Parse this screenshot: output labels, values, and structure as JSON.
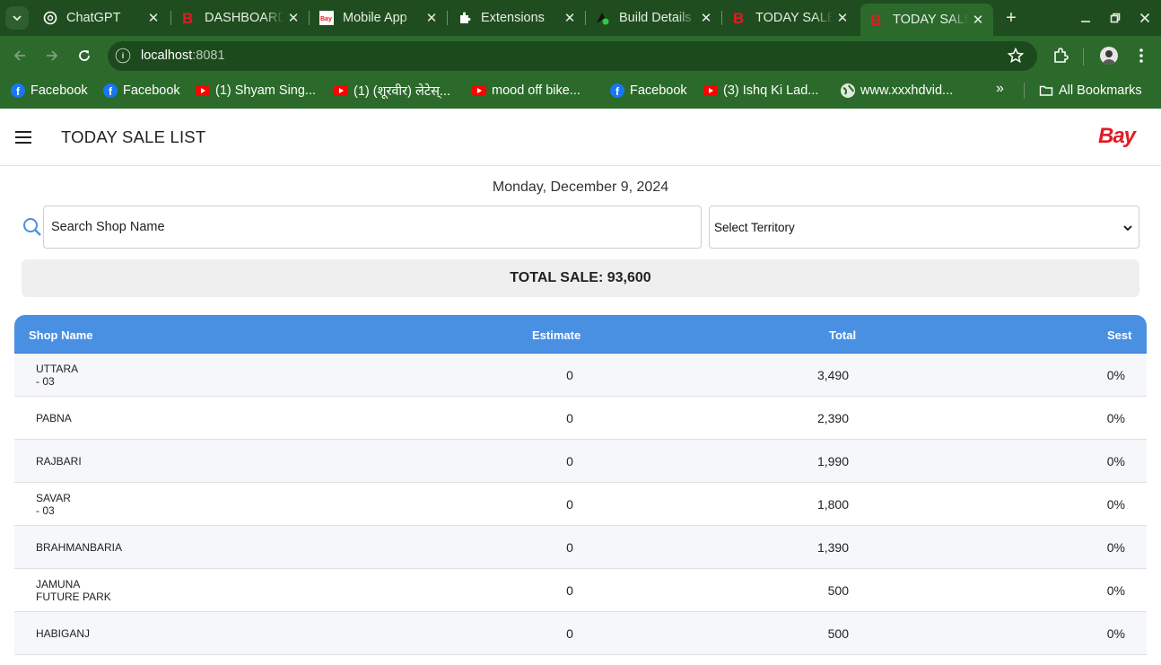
{
  "browser": {
    "tabs": [
      {
        "title": "ChatGPT",
        "icon": "chatgpt-icon"
      },
      {
        "title": "DASHBOARD",
        "icon": "b-red-icon"
      },
      {
        "title": "Mobile App",
        "icon": "bay-icon"
      },
      {
        "title": "Extensions",
        "icon": "puzzle-icon"
      },
      {
        "title": "Build Details",
        "icon": "build-icon"
      },
      {
        "title": "TODAY SALE",
        "icon": "b-red-icon"
      },
      {
        "title": "TODAY SALE",
        "icon": "b-red-icon",
        "active": true
      }
    ],
    "url_host": "localhost",
    "url_port": ":8081",
    "bookmarks": [
      {
        "label": "Facebook",
        "icon": "facebook-icon"
      },
      {
        "label": "Facebook",
        "icon": "facebook-icon"
      },
      {
        "label": "(1) Shyam Sing...",
        "icon": "youtube-icon"
      },
      {
        "label": "(1) (शूरवीर) लेटेस्...",
        "icon": "youtube-icon"
      },
      {
        "label": "mood off bike...",
        "icon": "youtube-icon"
      },
      {
        "label": "Facebook",
        "icon": "facebook-icon"
      },
      {
        "label": "(3) Ishq Ki Lad...",
        "icon": "youtube-icon"
      },
      {
        "label": "www.xxxhdvid...",
        "icon": "globe-icon"
      }
    ],
    "more_bookmarks": "»",
    "all_bookmarks": "All Bookmarks",
    "theme_color": "#2b6a2b"
  },
  "app": {
    "title": "TODAY SALE LIST",
    "logo_text": "Bay",
    "brand_color": "#e21b23",
    "date": "Monday, December 9, 2024",
    "search_placeholder": "Search Shop Name",
    "territory_selected": "Select Territory",
    "total_sale": "TOTAL SALE: 93,600",
    "table": {
      "header_color": "#4a90e2",
      "columns": [
        "Shop Name",
        "Estimate",
        "Total",
        "Sest"
      ],
      "rows": [
        {
          "name_line1": "UTTARA",
          "name_line2": "- 03",
          "estimate": "0",
          "total": "3,490",
          "sest": "0%"
        },
        {
          "name_line1": "PABNA",
          "name_line2": "",
          "estimate": "0",
          "total": "2,390",
          "sest": "0%"
        },
        {
          "name_line1": "RAJBARI",
          "name_line2": "",
          "estimate": "0",
          "total": "1,990",
          "sest": "0%"
        },
        {
          "name_line1": "SAVAR",
          "name_line2": "- 03",
          "estimate": "0",
          "total": "1,800",
          "sest": "0%"
        },
        {
          "name_line1": "BRAHMANBARIA",
          "name_line2": "",
          "estimate": "0",
          "total": "1,390",
          "sest": "0%"
        },
        {
          "name_line1": "JAMUNA",
          "name_line2": "FUTURE PARK",
          "estimate": "0",
          "total": "500",
          "sest": "0%"
        },
        {
          "name_line1": "HABIGANJ",
          "name_line2": "",
          "estimate": "0",
          "total": "500",
          "sest": "0%"
        }
      ]
    }
  }
}
